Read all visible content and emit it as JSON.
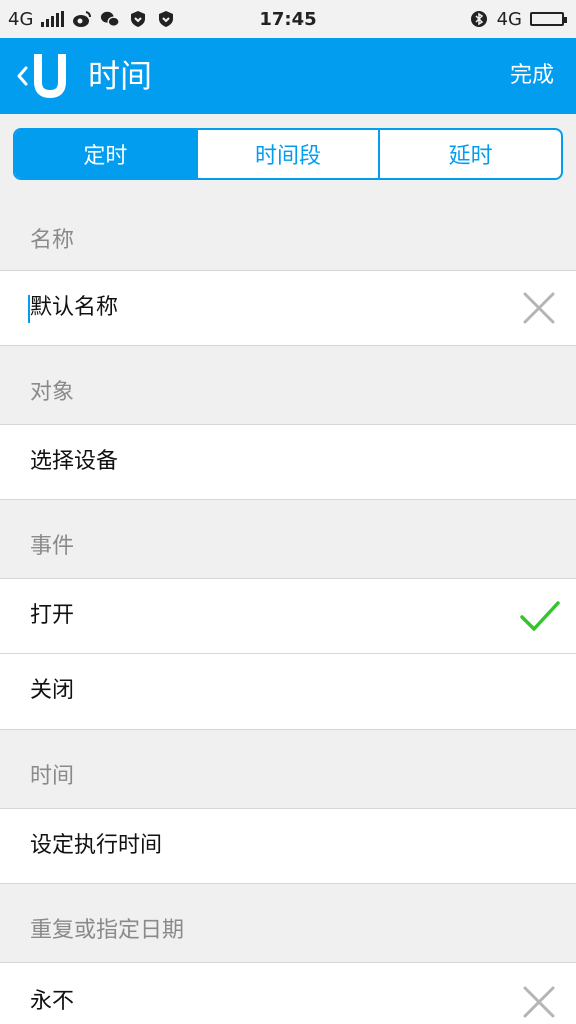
{
  "status_bar": {
    "network_left": "4G",
    "time": "17:45",
    "network_right": "4G",
    "icons": [
      "weibo-icon",
      "wechat-icon",
      "shield-icon",
      "shield-icon",
      "bluetooth-icon",
      "battery-icon"
    ]
  },
  "header": {
    "title": "时间",
    "done_label": "完成",
    "back_icon": "chevron-left-icon",
    "logo_icon": "u-logo-icon"
  },
  "tabs": [
    {
      "label": "定时",
      "active": true
    },
    {
      "label": "时间段",
      "active": false
    },
    {
      "label": "延时",
      "active": false
    }
  ],
  "sections": {
    "name": {
      "header": "名称",
      "input_value": "默认名称"
    },
    "object": {
      "header": "对象",
      "row_label": "选择设备"
    },
    "event": {
      "header": "事件",
      "options": [
        {
          "label": "打开",
          "selected": true
        },
        {
          "label": "关闭",
          "selected": false
        }
      ]
    },
    "time": {
      "header": "时间",
      "row_label": "设定执行时间"
    },
    "repeat": {
      "header": "重复或指定日期",
      "row_label": "永不"
    }
  },
  "colors": {
    "accent": "#039df0",
    "check": "#33c52b",
    "section_bg": "#f0f0f0",
    "section_text": "#8a8a8a"
  }
}
